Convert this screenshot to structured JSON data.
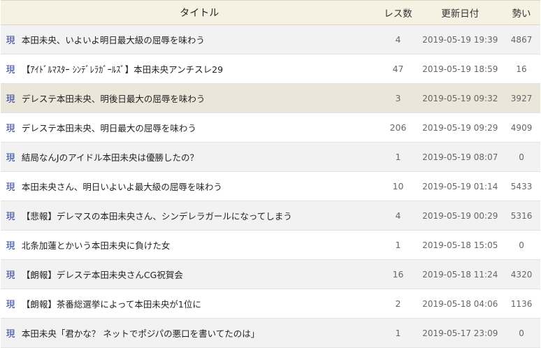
{
  "header": {
    "title": "タイトル",
    "res_count": "レス数",
    "updated": "更新日付",
    "momentum": "勢い"
  },
  "threads": [
    {
      "status": "現",
      "title": "本田未央、いよいよ明日最大級の屈辱を味わう",
      "res": "4",
      "date": "2019-05-19 19:39",
      "momentum": "4867"
    },
    {
      "status": "現",
      "title": "【ｱｲﾄﾞﾙﾏｽﾀｰ ｼﾝﾃﾞﾚﾗｶﾞｰﾙｽﾞ】本田未央アンチスレ29",
      "res": "47",
      "date": "2019-05-19 18:59",
      "momentum": "16"
    },
    {
      "status": "現",
      "title": "デレステ本田未央、明後日最大の屈辱を味わう",
      "res": "3",
      "date": "2019-05-19 09:32",
      "momentum": "3927"
    },
    {
      "status": "現",
      "title": "デレステ本田未央、明日最大の屈辱を味わう",
      "res": "206",
      "date": "2019-05-19 09:29",
      "momentum": "4909"
    },
    {
      "status": "現",
      "title": "結局なんJのアイドル本田未央は優勝したの？",
      "res": "1",
      "date": "2019-05-19 08:07",
      "momentum": "0"
    },
    {
      "status": "現",
      "title": "本田未央さん、明日いよいよ最大級の屈辱を味わう",
      "res": "10",
      "date": "2019-05-19 01:14",
      "momentum": "5433"
    },
    {
      "status": "現",
      "title": "【悲報】デレマスの本田未央さん、シンデレラガールになってしまう",
      "res": "4",
      "date": "2019-05-19 00:29",
      "momentum": "5316"
    },
    {
      "status": "現",
      "title": "北条加蓮とかいう本田未央に負けた女",
      "res": "1",
      "date": "2019-05-18 15:05",
      "momentum": "0"
    },
    {
      "status": "現",
      "title": "【朗報】デレステ本田未央さんCG祝賀会",
      "res": "16",
      "date": "2019-05-18 11:24",
      "momentum": "4320"
    },
    {
      "status": "現",
      "title": "【朗報】茶番総選挙によって本田未央が1位に",
      "res": "2",
      "date": "2019-05-18 04:06",
      "momentum": "1136"
    },
    {
      "status": "現",
      "title": "本田未央「君かな？ ネットでポジパの悪口を書いてたのは」",
      "res": "1",
      "date": "2019-05-17 23:09",
      "momentum": "0"
    }
  ]
}
